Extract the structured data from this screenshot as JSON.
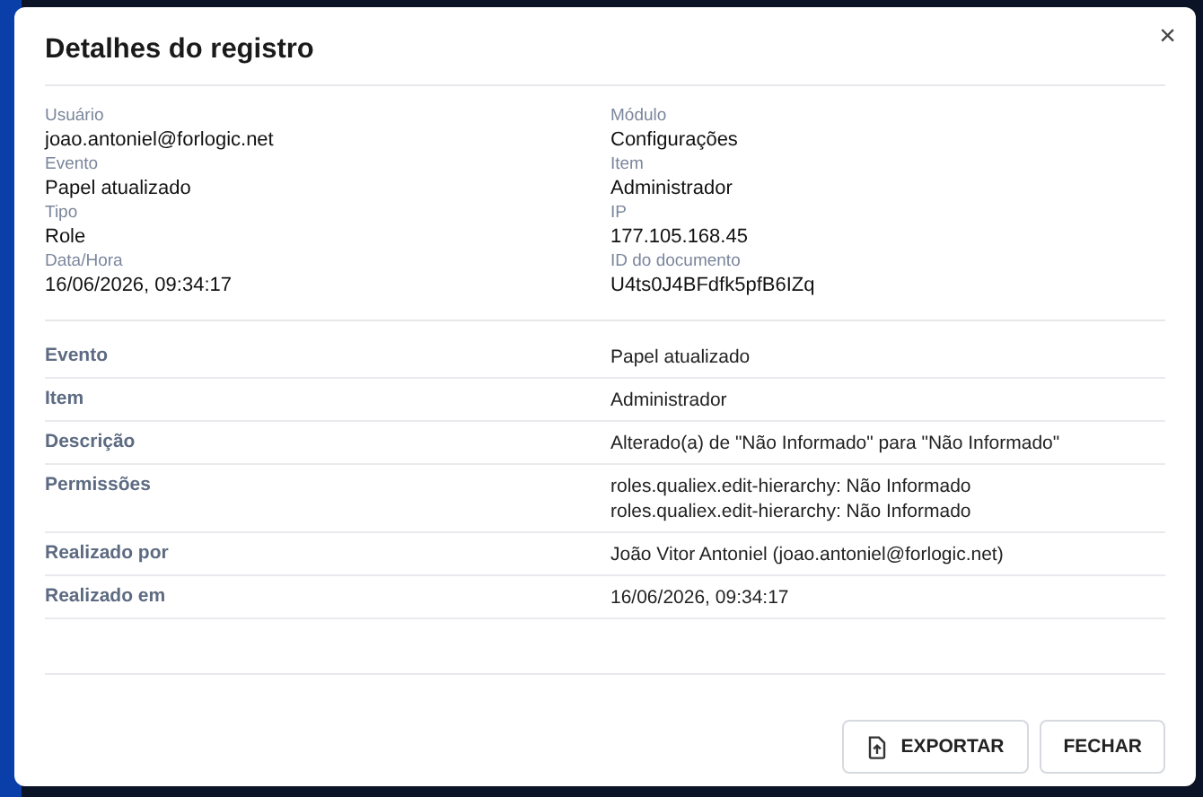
{
  "dialog": {
    "title": "Detalhes do registro",
    "close": "×"
  },
  "summary": [
    {
      "label": "Usuário",
      "value": "joao.antoniel@forlogic.net"
    },
    {
      "label": "Módulo",
      "value": "Configurações"
    },
    {
      "label": "Evento",
      "value": "Papel atualizado"
    },
    {
      "label": "Item",
      "value": "Administrador"
    },
    {
      "label": "Tipo",
      "value": "Role"
    },
    {
      "label": "IP",
      "value": "177.105.168.45"
    },
    {
      "label": "Data/Hora",
      "value": "16/06/2026, 09:34:17"
    },
    {
      "label": "ID do documento",
      "value": "U4ts0J4BFdfk5pfB6IZq"
    }
  ],
  "details": [
    {
      "field": "Evento",
      "lines": [
        "Papel atualizado"
      ]
    },
    {
      "field": "Item",
      "lines": [
        "Administrador"
      ]
    },
    {
      "field": "Descrição",
      "lines": [
        "Alterado(a) de \"Não Informado\" para \"Não Informado\""
      ]
    },
    {
      "field": "Permissões",
      "lines": [
        "roles.qualiex.edit-hierarchy: Não Informado",
        "roles.qualiex.edit-hierarchy: Não Informado"
      ]
    },
    {
      "field": "Realizado por",
      "lines": [
        "João Vitor Antoniel (joao.antoniel@forlogic.net)"
      ]
    },
    {
      "field": "Realizado em",
      "lines": [
        "16/06/2026, 09:34:17"
      ]
    }
  ],
  "buttons": [
    {
      "label": "EXPORTAR",
      "kind": "export"
    },
    {
      "label": "FECHAR",
      "kind": "plain"
    }
  ]
}
